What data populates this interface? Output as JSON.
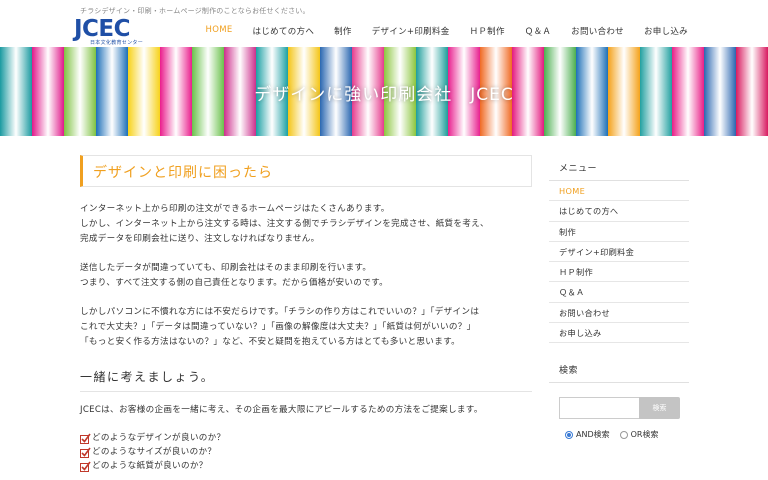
{
  "header": {
    "tagline": "チラシデザイン・印刷・ホームページ制作のことならお任せください。",
    "logo_text": "JCEC",
    "logo_sub": "日本文化教育センター",
    "nav": [
      {
        "label": "HOME",
        "active": true
      },
      {
        "label": "はじめての方へ"
      },
      {
        "label": "制作"
      },
      {
        "label": "デザイン+印刷料金"
      },
      {
        "label": "ＨＰ制作"
      },
      {
        "label": "Ｑ＆Ａ"
      },
      {
        "label": "お問い合わせ"
      },
      {
        "label": "お申し込み"
      }
    ],
    "accent_color": "#f0a020",
    "brand_color": "#1f4fa6"
  },
  "banner": {
    "title": "デザインに強い印刷会社　JCEC",
    "stripe_colors": [
      "#1a9aa0",
      "#e0198a",
      "#7fc242",
      "#1d6fb8",
      "#f7d21a",
      "#ea1d8c",
      "#6ac14b",
      "#cc2f8c",
      "#1ba0a4",
      "#f4c517",
      "#2a67b1",
      "#e63b8d",
      "#8cc63f",
      "#1e9e9b",
      "#e8208f",
      "#f06a23",
      "#e4197f",
      "#4caf50",
      "#1d70b7",
      "#f4a21b",
      "#21a0a0",
      "#e91e87",
      "#2b66b0",
      "#d81b60"
    ]
  },
  "main": {
    "heading": "デザインと印刷に困ったら",
    "p1": [
      "インターネット上から印刷の注文ができるホームページはたくさんあります。",
      "しかし、インターネット上から注文する時は、注文する側でチラシデザインを完成させ、紙質を考え、",
      "完成データを印刷会社に送り、注文しなければなりません。"
    ],
    "p2": [
      "送信したデータが間違っていても、印刷会社はそのまま印刷を行います。",
      "つまり、すべて注文する側の自己責任となります。だから価格が安いのです。"
    ],
    "p3": [
      "しかしパソコンに不慣れな方には不安だらけです。「チラシの作り方はこれでいいの？」「デザインは",
      "これで大丈夫？」「データは間違っていない？」「画像の解像度は大丈夫？」「紙質は何がいいの？」",
      "「もっと安く作る方法はないの？」など、不安と疑問を抱えている方はとても多いと思います。"
    ],
    "section2": "一緒に考えましょう。",
    "lead": "JCECは、お客様の企画を一緒に考え、その企画を最大限にアピールするための方法をご提案します。",
    "checks": [
      "どのようなデザインが良いのか？",
      "どのようなサイズが良いのか？",
      "どのような紙質が良いのか？"
    ]
  },
  "sidebar": {
    "menu_title": "メニュー",
    "menu": [
      {
        "label": "HOME",
        "active": true
      },
      {
        "label": "はじめての方へ"
      },
      {
        "label": "制作"
      },
      {
        "label": "デザイン+印刷料金"
      },
      {
        "label": "ＨＰ制作"
      },
      {
        "label": "Ｑ＆Ａ"
      },
      {
        "label": "お問い合わせ"
      },
      {
        "label": "お申し込み"
      }
    ],
    "search_title": "検索",
    "search_value": "",
    "search_button": "検索",
    "radio_and": "AND検索",
    "radio_or": "OR検索",
    "radio_selected": "and"
  }
}
